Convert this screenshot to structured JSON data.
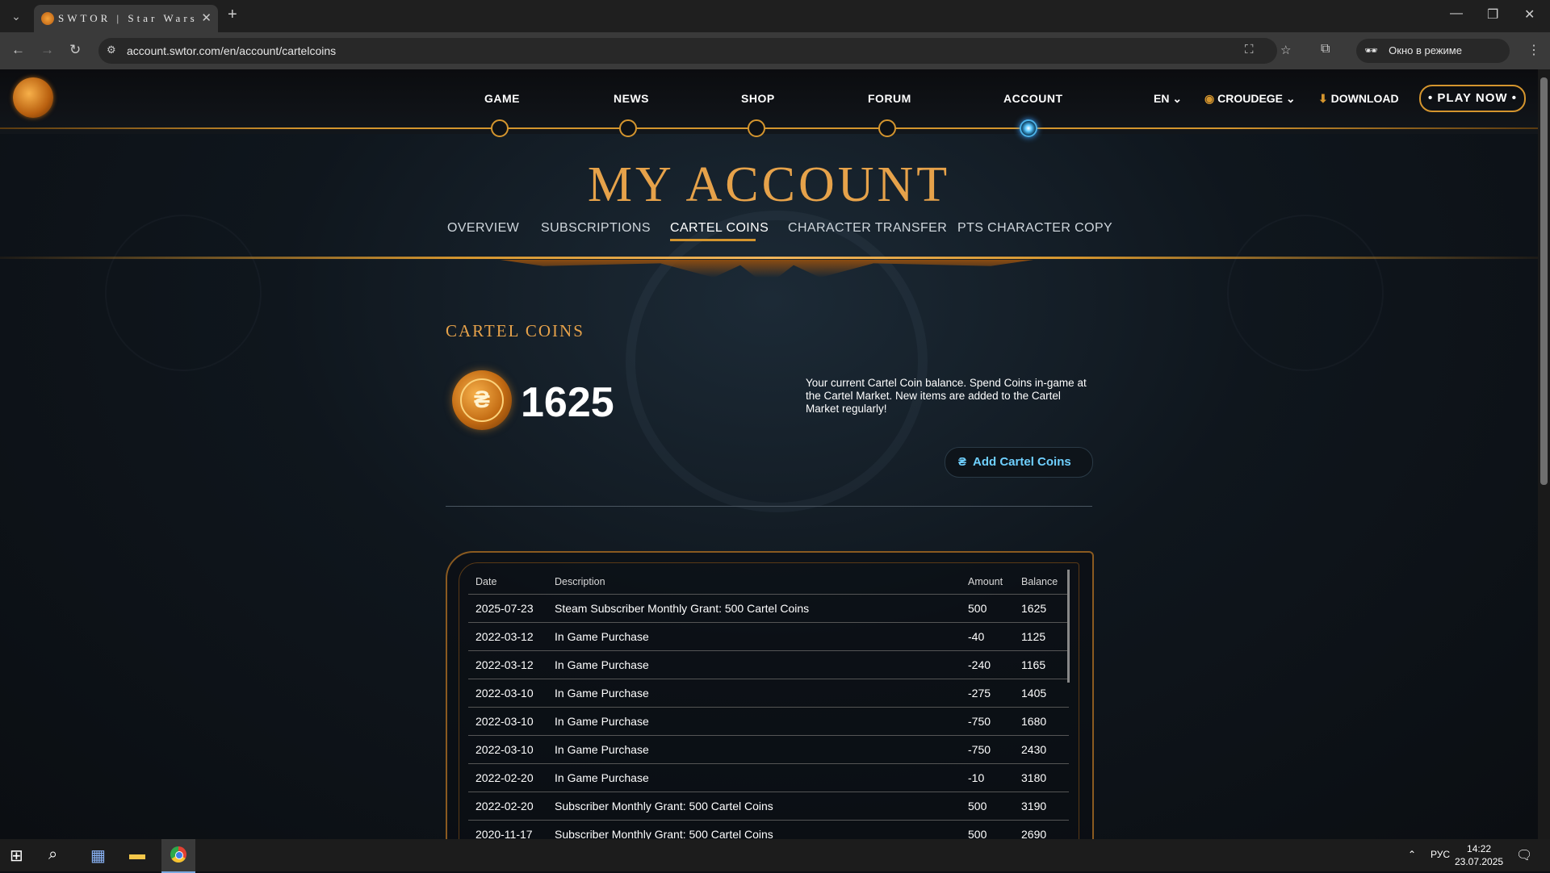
{
  "browser": {
    "tab_title": "SWTOR | Star Wars: The Old Re",
    "url": "account.swtor.com/en/account/cartelcoins",
    "incognito_label": "Окно в режиме инкогнито"
  },
  "site": {
    "nav": [
      "GAME",
      "NEWS",
      "SHOP",
      "FORUM",
      "ACCOUNT"
    ],
    "active_nav": "ACCOUNT",
    "lang": "EN",
    "user": "CROUDEGE",
    "download": "DOWNLOAD",
    "play_now": "• PLAY NOW •",
    "page_title": "MY ACCOUNT",
    "subnav": [
      "OVERVIEW",
      "SUBSCRIPTIONS",
      "CARTEL COINS",
      "CHARACTER TRANSFER",
      "PTS CHARACTER COPY"
    ],
    "active_subnav": "CARTEL COINS"
  },
  "cartel": {
    "heading": "CARTEL COINS",
    "balance": "1625",
    "description": "Your current Cartel Coin balance. Spend Coins in-game at the Cartel Market. New items are added to the Cartel Market regularly!",
    "add_button": "Add Cartel Coins"
  },
  "table": {
    "headers": [
      "Date",
      "Description",
      "Amount",
      "Balance"
    ],
    "rows": [
      {
        "date": "2025-07-23",
        "desc": "Steam Subscriber Monthly Grant: 500 Cartel Coins",
        "amount": "500",
        "balance": "1625"
      },
      {
        "date": "2022-03-12",
        "desc": "In Game Purchase",
        "amount": "-40",
        "balance": "1125"
      },
      {
        "date": "2022-03-12",
        "desc": "In Game Purchase",
        "amount": "-240",
        "balance": "1165"
      },
      {
        "date": "2022-03-10",
        "desc": "In Game Purchase",
        "amount": "-275",
        "balance": "1405"
      },
      {
        "date": "2022-03-10",
        "desc": "In Game Purchase",
        "amount": "-750",
        "balance": "1680"
      },
      {
        "date": "2022-03-10",
        "desc": "In Game Purchase",
        "amount": "-750",
        "balance": "2430"
      },
      {
        "date": "2022-02-20",
        "desc": "In Game Purchase",
        "amount": "-10",
        "balance": "3180"
      },
      {
        "date": "2022-02-20",
        "desc": "Subscriber Monthly Grant: 500 Cartel Coins",
        "amount": "500",
        "balance": "3190"
      },
      {
        "date": "2020-11-17",
        "desc": "Subscriber Monthly Grant: 500 Cartel Coins",
        "amount": "500",
        "balance": "2690"
      }
    ]
  },
  "taskbar": {
    "lang": "РУС",
    "time": "14:22",
    "date": "23.07.2025"
  }
}
